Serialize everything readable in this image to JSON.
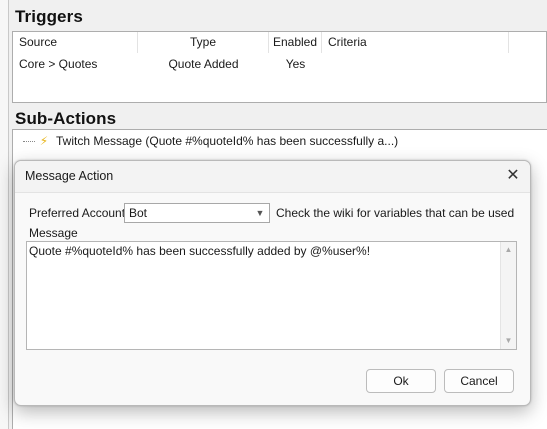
{
  "triggers": {
    "heading": "Triggers",
    "columns": [
      "Source",
      "Type",
      "Enabled",
      "Criteria"
    ],
    "rows": [
      {
        "source": "Core > Quotes",
        "type": "Quote Added",
        "enabled": "Yes",
        "criteria": ""
      }
    ]
  },
  "subactions": {
    "heading": "Sub-Actions",
    "items": [
      {
        "icon": "lightning-bolt-icon",
        "label": "Twitch Message (Quote #%quoteId% has been successfully a...)"
      }
    ]
  },
  "dialog": {
    "title": "Message Action",
    "close_glyph": "✕",
    "preferred_account_label": "Preferred Account",
    "preferred_account_value": "Bot",
    "wiki_hint": "Check the wiki for variables that can be used",
    "message_label": "Message",
    "message_text": "Quote #%quoteId% has been successfully added by @%user%!",
    "ok_label": "Ok",
    "cancel_label": "Cancel"
  },
  "colors": {
    "bolt": "#e8b51a",
    "window_bg": "#f0f0f0"
  }
}
